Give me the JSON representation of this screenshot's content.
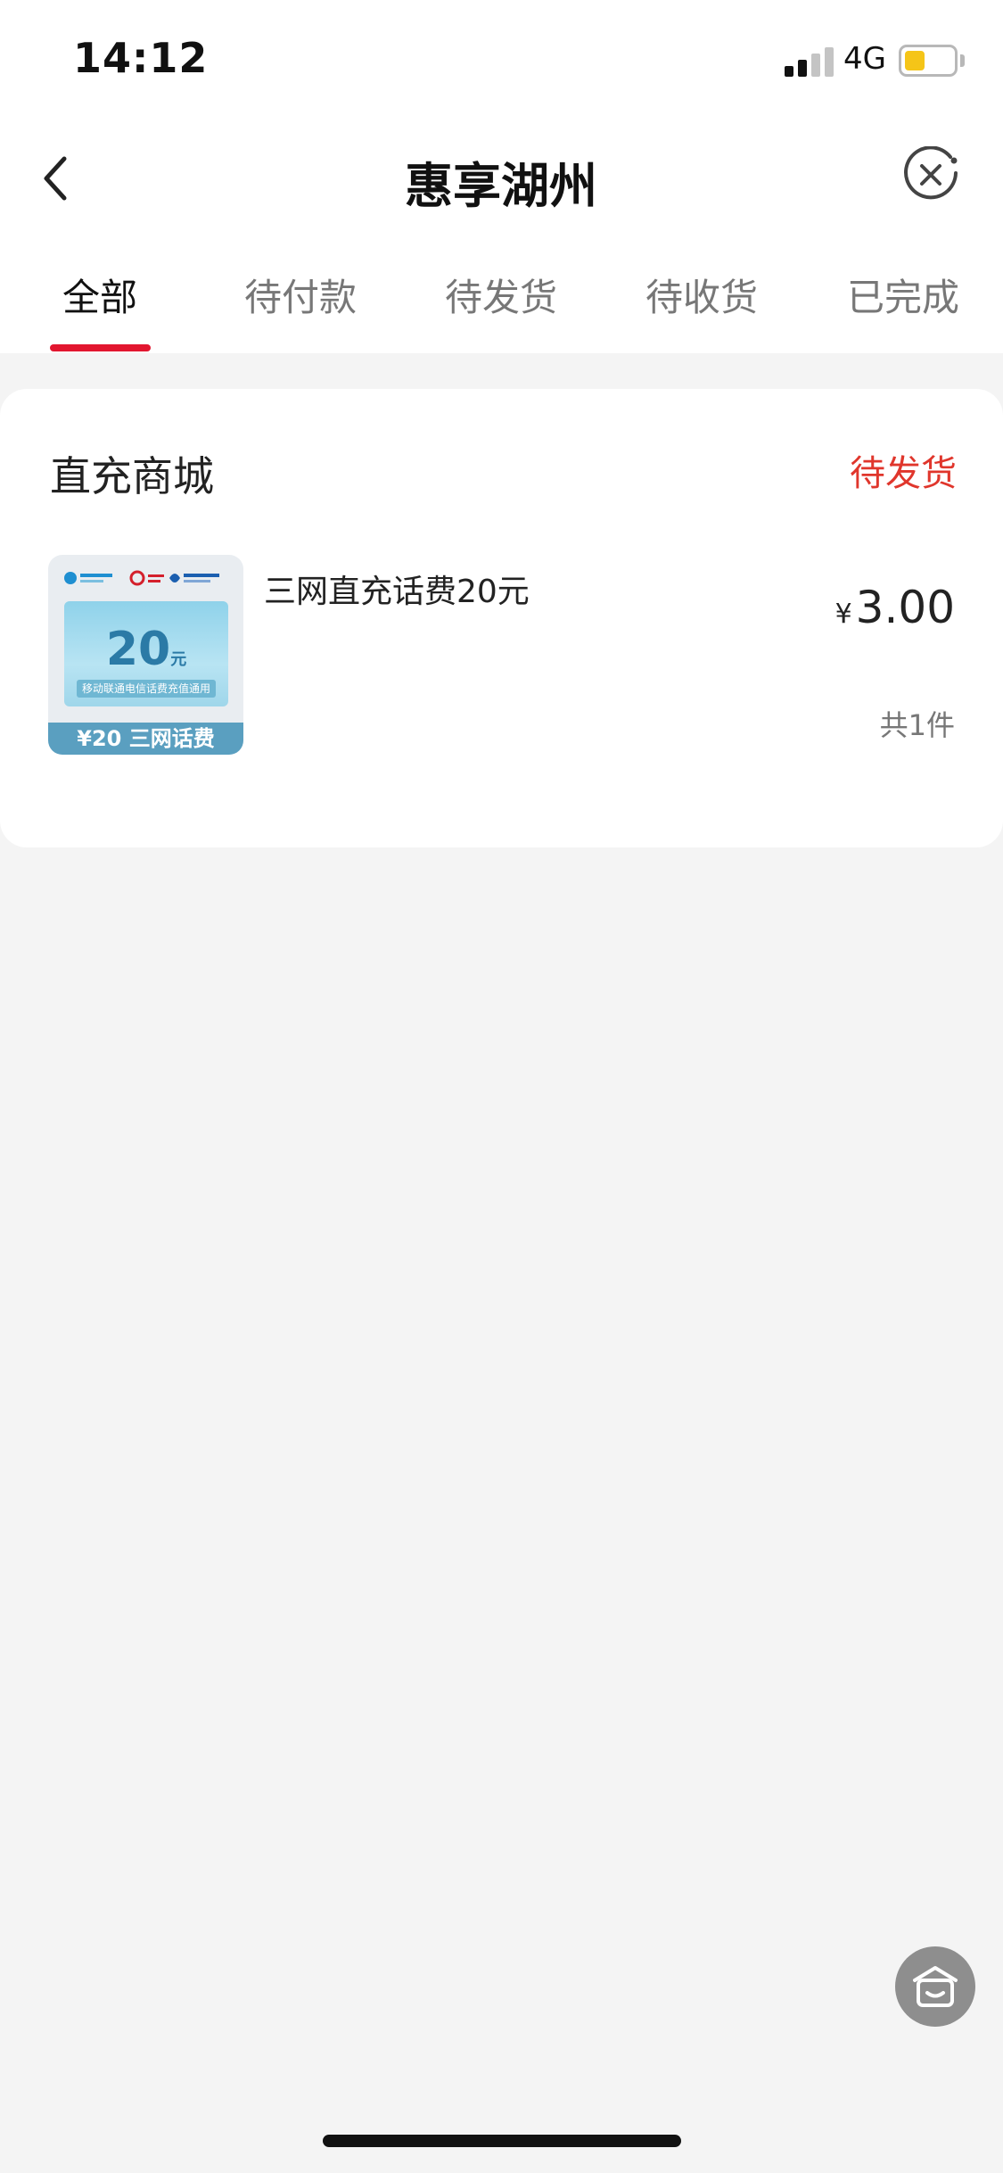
{
  "status_bar": {
    "time": "14:12",
    "network": "4G",
    "signal_bars_active": 2,
    "signal_bars_total": 4,
    "battery_level": 0.4,
    "battery_color": "#f5c518"
  },
  "nav": {
    "title": "惠享湖州",
    "back_icon": "chevron-left-icon",
    "close_icon": "close-circle-icon"
  },
  "tabs": [
    {
      "label": "全部",
      "active": true
    },
    {
      "label": "待付款",
      "active": false
    },
    {
      "label": "待发货",
      "active": false
    },
    {
      "label": "待收货",
      "active": false
    },
    {
      "label": "已完成",
      "active": false
    }
  ],
  "order": {
    "shop_name": "直充商城",
    "status": "待发货",
    "status_color": "#e0362c",
    "item": {
      "title": "三网直充话费20元",
      "currency": "¥",
      "price": "3.00",
      "quantity_text": "共1件",
      "thumbnail": {
        "amount": "20",
        "amount_unit": "元",
        "caption": "移动联通电信话费充值通用",
        "footer": "¥20 三网话费"
      }
    }
  },
  "fab_icon": "home-icon",
  "accent_color": "#e2162f"
}
